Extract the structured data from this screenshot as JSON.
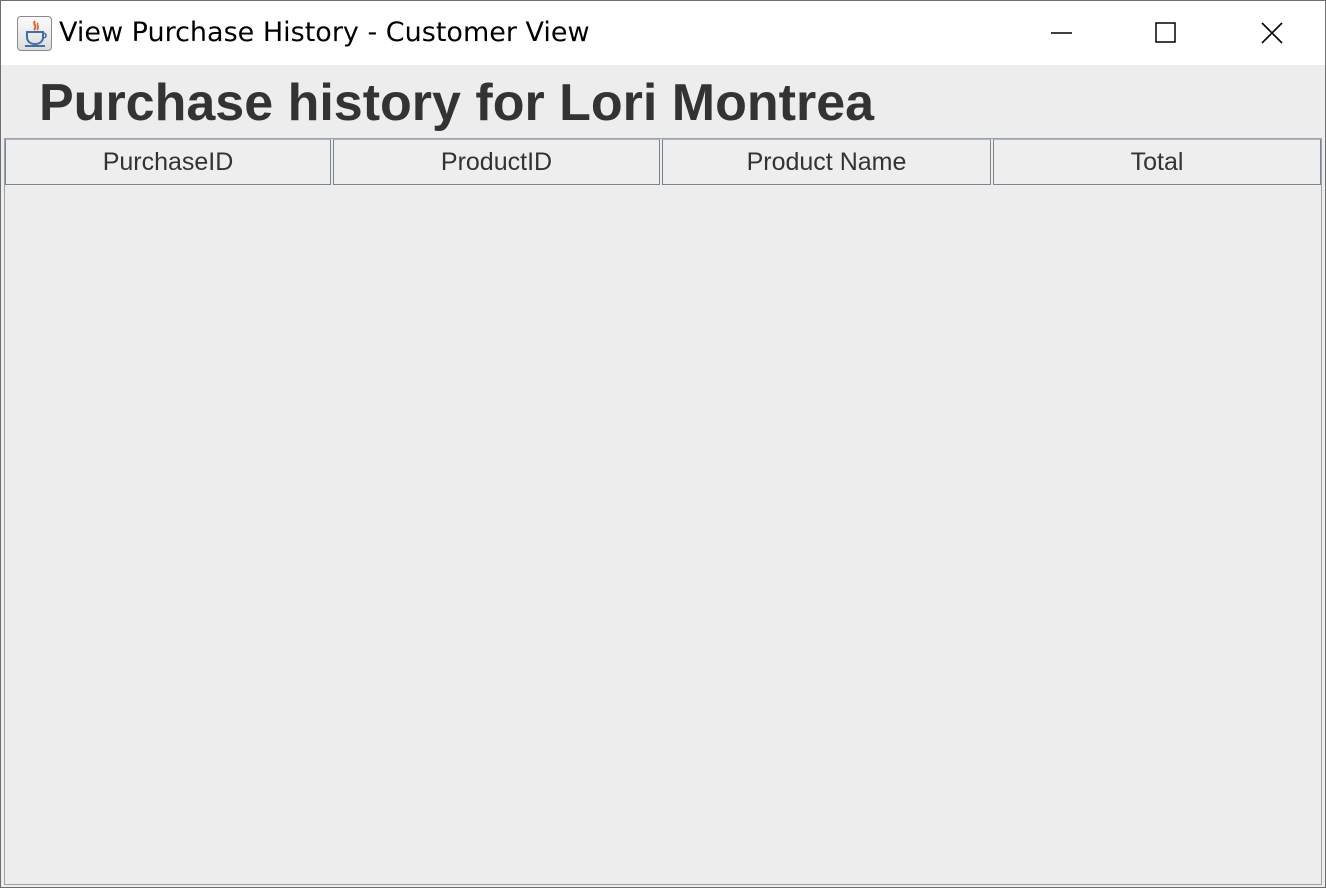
{
  "window": {
    "title": "View Purchase History - Customer View",
    "icon": "java-cup-icon"
  },
  "window_controls": {
    "minimize": "minimize-icon",
    "maximize": "maximize-icon",
    "close": "close-icon"
  },
  "main": {
    "heading": "Purchase history for Lori Montrea"
  },
  "table": {
    "columns": [
      "PurchaseID",
      "ProductID",
      "Product Name",
      "Total"
    ],
    "rows": []
  },
  "colors": {
    "background": "#ededed",
    "titlebar": "#ffffff",
    "heading_text": "#333333",
    "header_border": "#7a8591"
  }
}
